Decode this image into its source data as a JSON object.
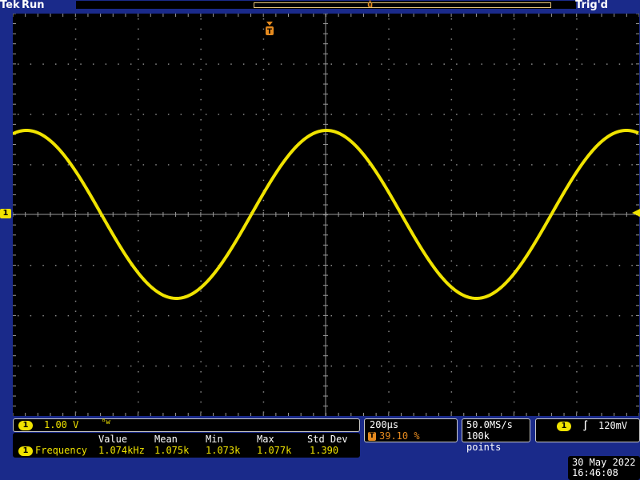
{
  "top": {
    "brand": "Tek",
    "run_status": "Run",
    "trigger_status": "Trig'd"
  },
  "vertical": {
    "channel": "1",
    "scale": "1.00 V",
    "bw_icon": "bandwidth-limit-icon"
  },
  "horizontal": {
    "timebase": "200µs",
    "trigger_pos_icon": "T",
    "trigger_pos": "39.10 %",
    "sample_rate": "50.0MS/s",
    "record_length": "100k points"
  },
  "trigger": {
    "channel": "1",
    "slope_icon": "rising-edge-icon",
    "slope_glyph": "∫",
    "level": "120mV"
  },
  "measurement": {
    "headers": [
      "Value",
      "Mean",
      "Min",
      "Max",
      "Std Dev"
    ],
    "channel": "1",
    "name": "Frequency",
    "values": [
      "1.074kHz",
      "1.075k",
      "1.073k",
      "1.077k",
      "1.390"
    ]
  },
  "datetime": {
    "date": "30 May 2022",
    "time": "16:46:08"
  },
  "colors": {
    "trace": "#f0e300",
    "frame": "#1a2a8a",
    "grid": "#8a8a8a",
    "trigger_marker": "#e58a1f"
  }
}
